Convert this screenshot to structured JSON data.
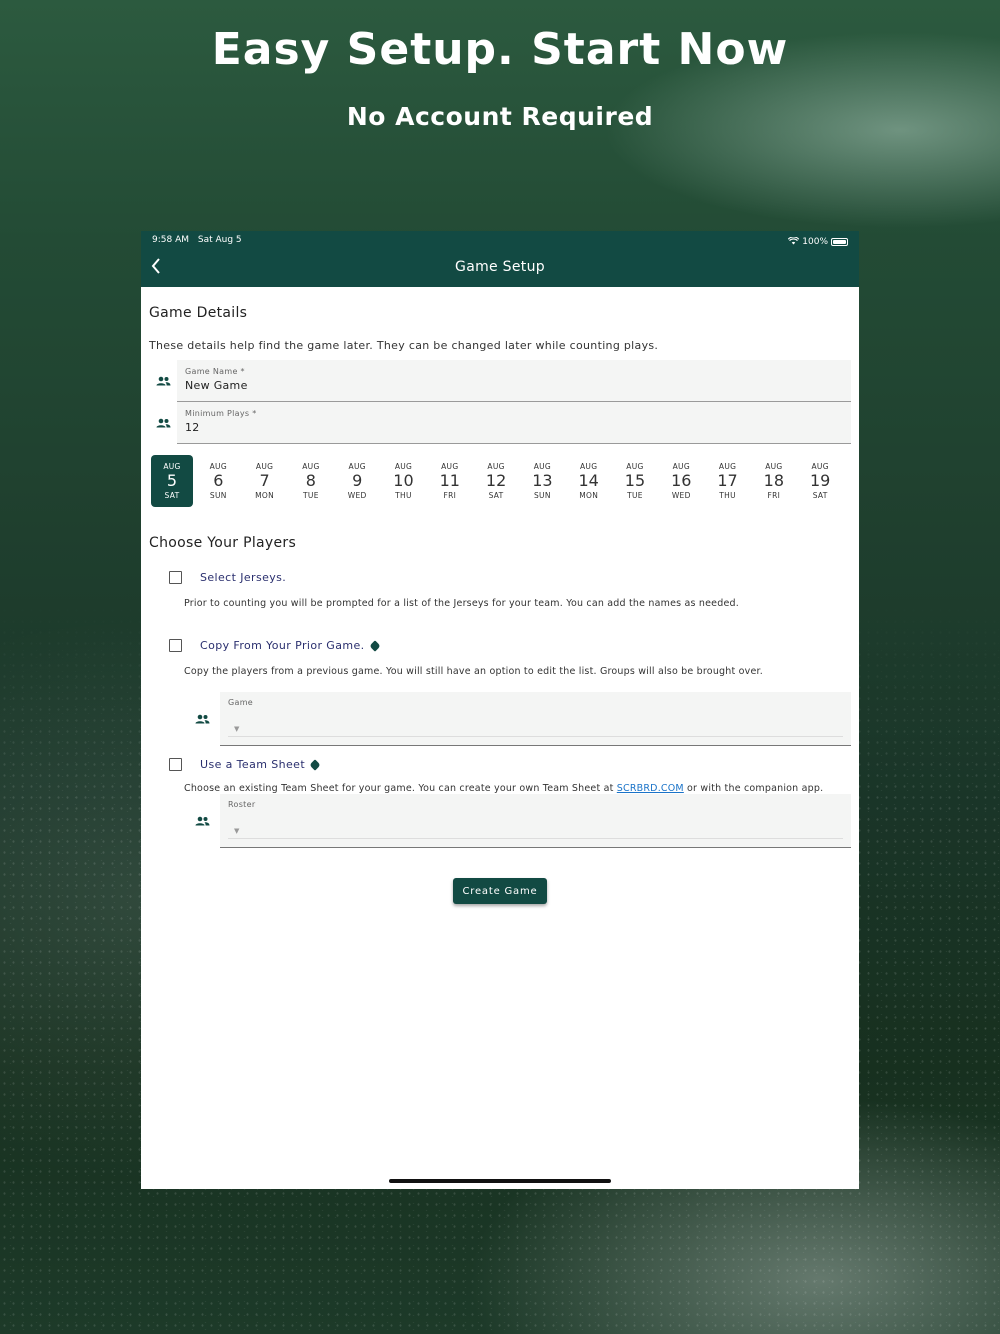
{
  "hero": {
    "title": "Easy Setup. Start Now",
    "subtitle": "No Account Required"
  },
  "status_bar": {
    "time": "9:58 AM",
    "date": "Sat Aug 5",
    "battery": "100%"
  },
  "app_bar": {
    "title": "Game Setup",
    "back_icon": "chevron-left-icon"
  },
  "game_details": {
    "title": "Game Details",
    "helper": "These details help find the game later. They can be changed later while counting plays.",
    "fields": [
      {
        "label": "Game Name *",
        "value": "New Game",
        "icon": "people-icon"
      },
      {
        "label": "Minimum Plays *",
        "value": "12",
        "icon": "people-icon"
      }
    ]
  },
  "dates": [
    {
      "month": "AUG",
      "day": "5",
      "weekday": "SAT",
      "selected": true
    },
    {
      "month": "AUG",
      "day": "6",
      "weekday": "SUN"
    },
    {
      "month": "AUG",
      "day": "7",
      "weekday": "MON"
    },
    {
      "month": "AUG",
      "day": "8",
      "weekday": "TUE"
    },
    {
      "month": "AUG",
      "day": "9",
      "weekday": "WED"
    },
    {
      "month": "AUG",
      "day": "10",
      "weekday": "THU"
    },
    {
      "month": "AUG",
      "day": "11",
      "weekday": "FRI"
    },
    {
      "month": "AUG",
      "day": "12",
      "weekday": "SAT"
    },
    {
      "month": "AUG",
      "day": "13",
      "weekday": "SUN"
    },
    {
      "month": "AUG",
      "day": "14",
      "weekday": "MON"
    },
    {
      "month": "AUG",
      "day": "15",
      "weekday": "TUE"
    },
    {
      "month": "AUG",
      "day": "16",
      "weekday": "WED"
    },
    {
      "month": "AUG",
      "day": "17",
      "weekday": "THU"
    },
    {
      "month": "AUG",
      "day": "18",
      "weekday": "FRI"
    },
    {
      "month": "AUG",
      "day": "19",
      "weekday": "SAT"
    }
  ],
  "players": {
    "title": "Choose Your Players",
    "select_jerseys": {
      "label": "Select Jerseys.",
      "description": "Prior to counting you will be prompted for a list of the Jerseys for your team. You can add the names as needed."
    },
    "copy_prior": {
      "label": "Copy From Your Prior Game.",
      "description": "Copy the players from a previous game. You will still have an option to edit the list. Groups will also be brought over.",
      "select_label": "Game"
    },
    "team_sheet": {
      "label": "Use a Team Sheet",
      "description_before": "Choose an existing Team Sheet for your game. You can create your own Team Sheet at ",
      "link": "SCRBRD.COM",
      "description_after": " or with the companion app.",
      "select_label": "Roster"
    }
  },
  "create_button": "Create Game",
  "colors": {
    "primary": "#124a43",
    "link": "#1a73c8",
    "option_label": "#2a2f6e"
  }
}
